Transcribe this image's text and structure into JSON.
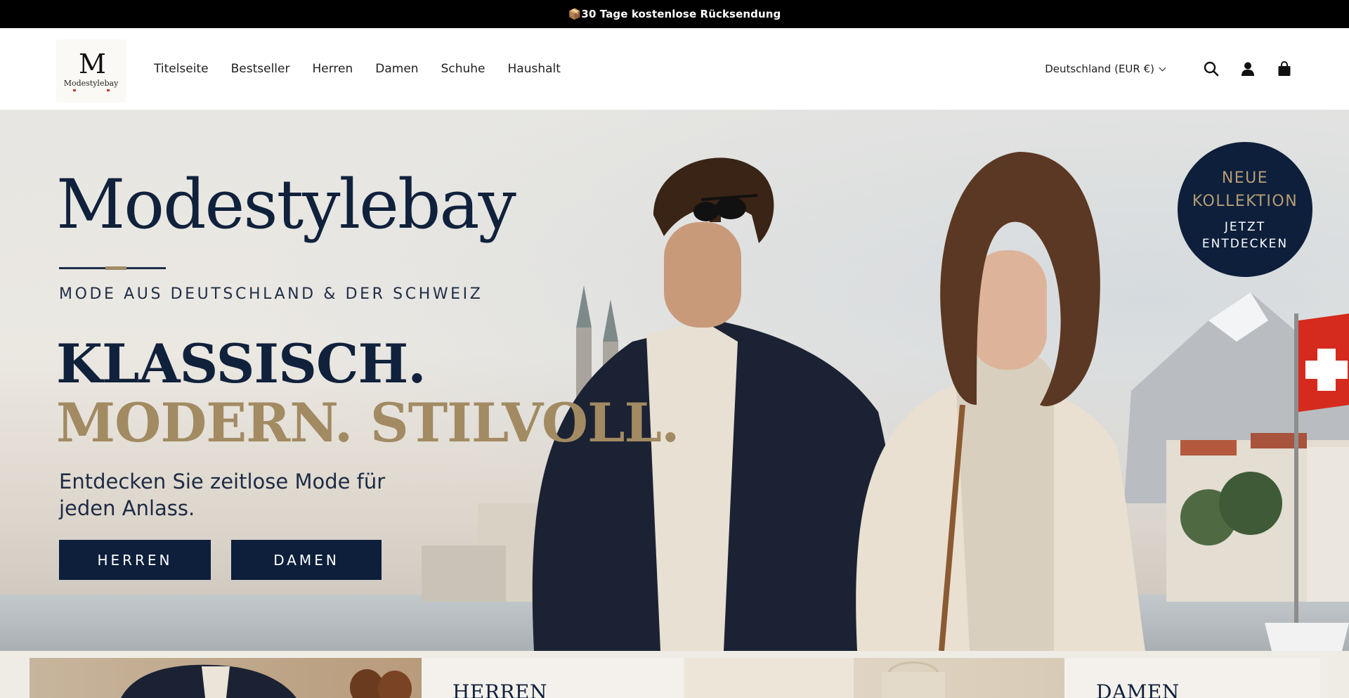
{
  "announcement": {
    "icon": "box-icon",
    "text": "📦30 Tage kostenlose Rücksendung"
  },
  "header": {
    "logo": {
      "monogram": "M",
      "wordmark": "Modestylebay"
    },
    "nav": [
      {
        "label": "Titelseite"
      },
      {
        "label": "Bestseller"
      },
      {
        "label": "Herren"
      },
      {
        "label": "Damen"
      },
      {
        "label": "Schuhe"
      },
      {
        "label": "Haushalt"
      }
    ],
    "locale": "Deutschland (EUR €)",
    "icons": [
      "search-icon",
      "account-icon",
      "cart-icon"
    ]
  },
  "hero": {
    "brand": "Modestylebay",
    "subtitle": "MODE AUS DEUTSCHLAND & DER SCHWEIZ",
    "headline_line1": "KLASSISCH.",
    "headline_line2": "MODERN. STILVOLL.",
    "description": "Entdecken Sie zeitlose Mode für jeden Anlass.",
    "buttons": {
      "herren": "HERREN",
      "damen": "DAMEN"
    },
    "badge": {
      "line1": "NEUE",
      "line2": "KOLLEKTION",
      "line3": "JETZT",
      "line4": "ENTDECKEN"
    }
  },
  "categories": [
    {
      "label": "HERREN"
    },
    {
      "label": "DAMEN"
    }
  ],
  "colors": {
    "navy": "#0d1f3b",
    "gold": "#a28a62",
    "announcement_bg": "#000000"
  }
}
